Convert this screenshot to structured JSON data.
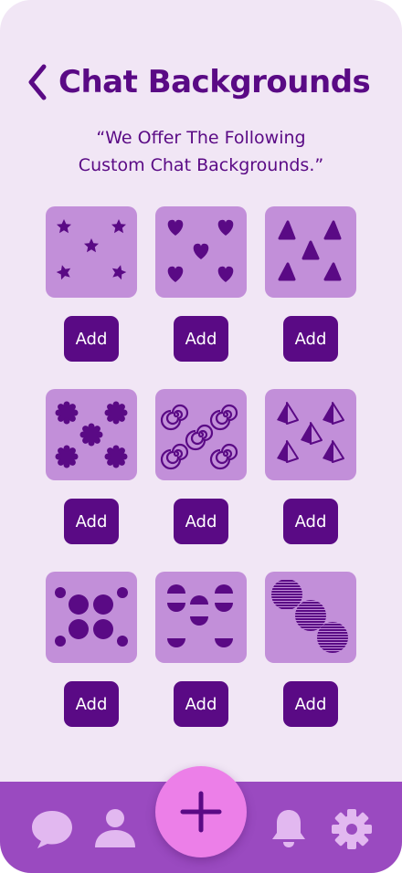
{
  "header": {
    "title": "Chat Backgrounds",
    "back_icon": "chevron-left-icon"
  },
  "subtitle": {
    "line1": "“We Offer The Following",
    "line2": "Custom Chat Backgrounds.”"
  },
  "backgrounds": [
    {
      "pattern": "stars",
      "button_label": "Add"
    },
    {
      "pattern": "hearts",
      "button_label": "Add"
    },
    {
      "pattern": "triangles",
      "button_label": "Add"
    },
    {
      "pattern": "badges",
      "button_label": "Add"
    },
    {
      "pattern": "spirals",
      "button_label": "Add"
    },
    {
      "pattern": "pyramids",
      "button_label": "Add"
    },
    {
      "pattern": "dots",
      "button_label": "Add"
    },
    {
      "pattern": "half-circles",
      "button_label": "Add"
    },
    {
      "pattern": "striped-circles",
      "button_label": "Add"
    }
  ],
  "bottom_nav": {
    "items": [
      {
        "icon": "chat-bubble-icon"
      },
      {
        "icon": "user-icon"
      },
      {
        "icon": "plus-icon"
      },
      {
        "icon": "bell-icon"
      },
      {
        "icon": "gear-icon"
      }
    ]
  },
  "colors": {
    "background": "#f1e6f5",
    "primary": "#5a0a85",
    "tile": "#c28fd9",
    "nav_bar": "#9a4ac0",
    "fab": "#ec7fe8",
    "nav_icon": "#e2b8f0"
  }
}
